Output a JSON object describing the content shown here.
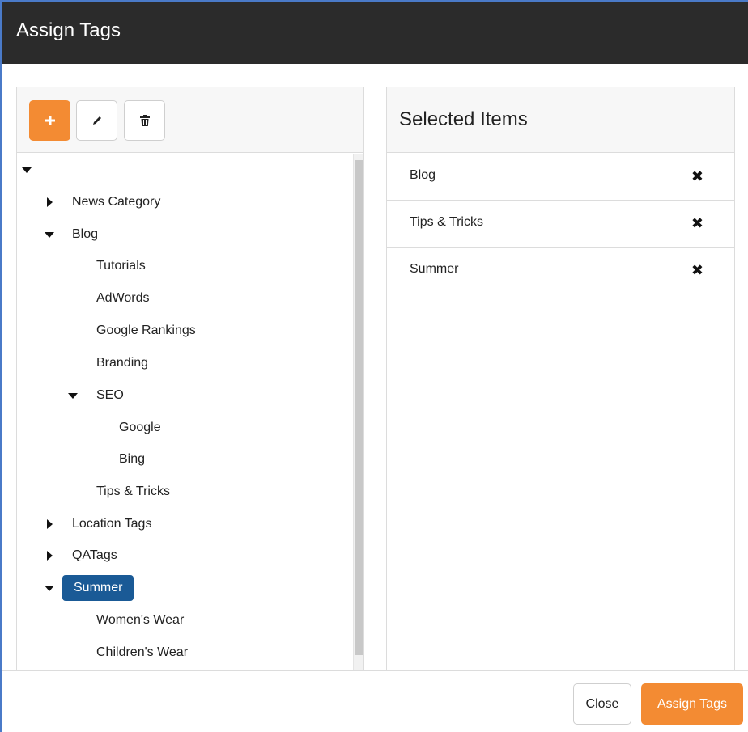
{
  "dialog": {
    "title": "Assign Tags"
  },
  "colors": {
    "accent": "#f38b33",
    "selected": "#1a5a96",
    "titlebar": "#2b2b2b"
  },
  "toolbar": {
    "add_icon": "plus-icon",
    "edit_icon": "pencil-icon",
    "delete_icon": "trash-icon"
  },
  "tree": {
    "root": {
      "expanded": true
    },
    "nodes": [
      {
        "label": "News Category",
        "expanded": false,
        "has_children": true
      },
      {
        "label": "Blog",
        "expanded": true,
        "has_children": true
      },
      {
        "label": "Tutorials"
      },
      {
        "label": "AdWords"
      },
      {
        "label": "Google Rankings"
      },
      {
        "label": "Branding"
      },
      {
        "label": "SEO",
        "expanded": true,
        "has_children": true
      },
      {
        "label": "Google"
      },
      {
        "label": "Bing"
      },
      {
        "label": "Tips & Tricks"
      },
      {
        "label": "Location Tags",
        "expanded": false,
        "has_children": true
      },
      {
        "label": "QATags",
        "expanded": false,
        "has_children": true
      },
      {
        "label": "Summer",
        "expanded": true,
        "has_children": true,
        "selected": true
      },
      {
        "label": "Women's Wear"
      },
      {
        "label": "Children's Wear"
      }
    ]
  },
  "selected_panel": {
    "heading": "Selected Items",
    "items": [
      {
        "label": "Blog",
        "remove_icon": "x-icon"
      },
      {
        "label": "Tips & Tricks",
        "remove_icon": "x-icon"
      },
      {
        "label": "Summer",
        "remove_icon": "x-icon"
      }
    ]
  },
  "footer": {
    "close_label": "Close",
    "assign_label": "Assign Tags"
  }
}
